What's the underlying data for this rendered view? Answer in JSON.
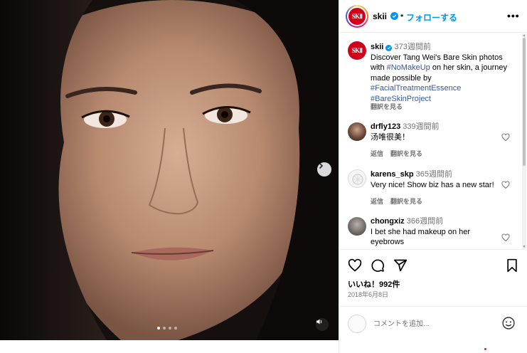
{
  "post": {
    "username": "skii",
    "follow_separator": "•",
    "follow_label": "フォローする",
    "more_label": "•••",
    "brand_logo": "SKⅡ",
    "caption": {
      "username": "skii",
      "time": "373週間前",
      "text_1": "Discover Tang Wei's Bare Skin photos with ",
      "tag_1": "#NoMakeUp",
      "text_2": " on her skin, a journey made possible by ",
      "tag_2": "#FacialTreatmentEssence",
      "tag_3": "#BareSkinProject",
      "translate": "翻訳を見る"
    },
    "comments": [
      {
        "username": "drfly123",
        "time": "339週間前",
        "text": "汤唯很美！",
        "reply": "返信",
        "translate": "翻訳を見る"
      },
      {
        "username": "karens_skp",
        "time": "365週間前",
        "text": "Very nice! Show biz has a new star!",
        "reply": "返信",
        "translate": "翻訳を見る"
      },
      {
        "username": "chongxiz",
        "time": "366週間前",
        "text": "I bet she had makeup on her eyebrows",
        "reply": "",
        "translate": ""
      }
    ],
    "likes": "いいね！992件",
    "date": "2018年6月8日",
    "comment_placeholder": "コメントを追加...",
    "carousel": {
      "count": 4,
      "active": 0
    }
  },
  "colors": {
    "accent": "#0095f6",
    "hashtag": "#385898",
    "brand_red": "#d0021b",
    "muted": "#737373"
  },
  "icons": [
    "chevron-right-icon",
    "speaker-icon",
    "verified-icon",
    "heart-icon",
    "comment-icon",
    "share-icon",
    "bookmark-icon",
    "emoji-icon",
    "more-icon"
  ]
}
